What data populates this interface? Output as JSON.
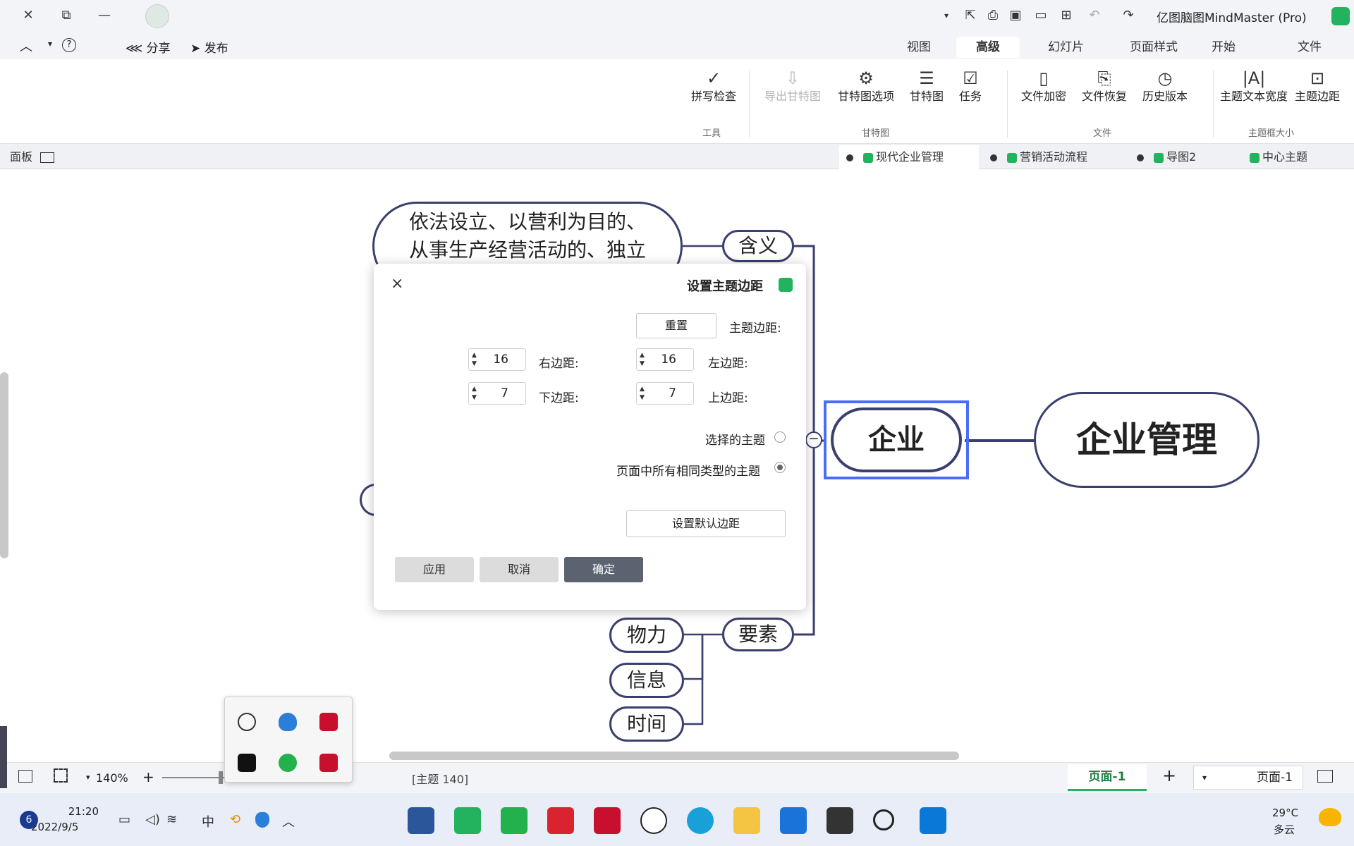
{
  "window": {
    "title": "亿图脑图MindMaster (Pro)",
    "minimize": "—",
    "restore": "⧉",
    "close": "✕"
  },
  "menu": {
    "tabs": [
      "文件",
      "开始",
      "页面样式",
      "幻灯片",
      "高级",
      "视图"
    ],
    "active_tab": "高级",
    "publish": "发布",
    "share": "分享",
    "help": "?"
  },
  "ribbon": {
    "groups": {
      "topic_size": "主题框大小",
      "file": "文件",
      "gantt": "甘特图",
      "tools": "工具"
    },
    "buttons": {
      "topic_margin": "主题边距",
      "topic_text_width": "主题文本宽度",
      "history": "历史版本",
      "file_recovery": "文件恢复",
      "file_encrypt": "文件加密",
      "task": "任务",
      "gantt": "甘特图",
      "gantt_options": "甘特图选项",
      "export_gantt": "导出甘特图",
      "spell_check": "拼写检查"
    }
  },
  "doc_tabs": [
    {
      "label": "中心主题",
      "active": false
    },
    {
      "label": "导图2",
      "active": false
    },
    {
      "label": "营销活动流程",
      "active": false
    },
    {
      "label": "现代企业管理",
      "active": true
    }
  ],
  "panel_label": "面板",
  "mindmap": {
    "center": "企业管理",
    "main": "企业",
    "branches": [
      "含义",
      "要素"
    ],
    "meaning_text_line1": "依法设立、以营利为目的、",
    "meaning_text_line2": "从事生产经营活动的、独立",
    "elements_children": [
      "物力",
      "信息",
      "时间"
    ],
    "collapse_symbol": "−"
  },
  "dialog": {
    "title": "设置主题边距",
    "close": "×",
    "topic_margin_label": "主题边距:",
    "reset": "重置",
    "left_label": "左边距:",
    "left_value": "16",
    "right_label": "右边距:",
    "right_value": "16",
    "top_label": "上边距:",
    "top_value": "7",
    "bottom_label": "下边距:",
    "bottom_value": "7",
    "option_selected": "选择的主题",
    "option_all_same": "页面中所有相同类型的主题",
    "selected_option": "all_same",
    "set_default": "设置默认边距",
    "ok": "确定",
    "cancel": "取消",
    "apply": "应用"
  },
  "statusbar": {
    "page_selector": "页面-1",
    "page_tab": "页面-1",
    "add_page": "+",
    "topic_info": "[主题 140]",
    "zoom": "140%",
    "zoom_plus": "+"
  },
  "taskbar": {
    "weather_temp": "29°C",
    "weather_desc": "多云",
    "time": "21:20",
    "date": "2022/9/5",
    "notifications": "6",
    "ime": "中"
  },
  "colors": {
    "accent": "#23b35f",
    "node_border": "#3a3f6e",
    "selection": "#4a6cf7",
    "primary_button": "#5b6270"
  }
}
